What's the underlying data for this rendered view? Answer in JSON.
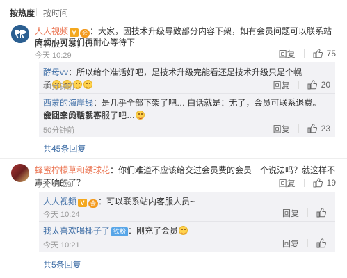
{
  "sort": {
    "hot": "按热度",
    "time": "按时间"
  },
  "comments": [
    {
      "user": "人人视频",
      "text_line1": "：大家，因技术升级导致部分内容下架，如有会员问题可以联系站内客服人员，还",
      "text_line2": "麻烦小可爱们再耐心等待下",
      "time": "今天 10:29",
      "reply_label": "回复",
      "likes": "75",
      "replies": [
        {
          "user": "酵母vv",
          "text": "：所以给个准话好吧，是技术升级完能看还是技术升级只是个幌子",
          "time": "44分钟前",
          "reply_label": "回复",
          "likes": "20"
        },
        {
          "user": "西蒙的海岸线",
          "text_line1": "：是几乎全部下架了吧… 白话就是：无了，会员可联系退费。能回来的话就不",
          "text_line2": "会让会员联系客服了吧…",
          "time": "50分钟前",
          "reply_label": "回复",
          "likes": "23"
        }
      ],
      "more": "共45条回复"
    },
    {
      "user": "蜂蜜柠檬草和绣球花",
      "text": "：你们难道不应该给交过会员费的会员一个说法吗？就这样不声不响的了？",
      "time": "今天 09:29",
      "reply_label": "回复",
      "likes": "19",
      "replies": [
        {
          "user": "人人视频",
          "text": "：可以联系站内客服人员~",
          "time": "今天 10:24",
          "reply_label": "回复",
          "likes": ""
        },
        {
          "user": "我太喜欢喝椰子了",
          "badge": "铁粉",
          "text": "：刚充了会员",
          "time": "今天 10:21",
          "reply_label": "回复",
          "likes": ""
        }
      ],
      "more": "共5条回复"
    }
  ]
}
